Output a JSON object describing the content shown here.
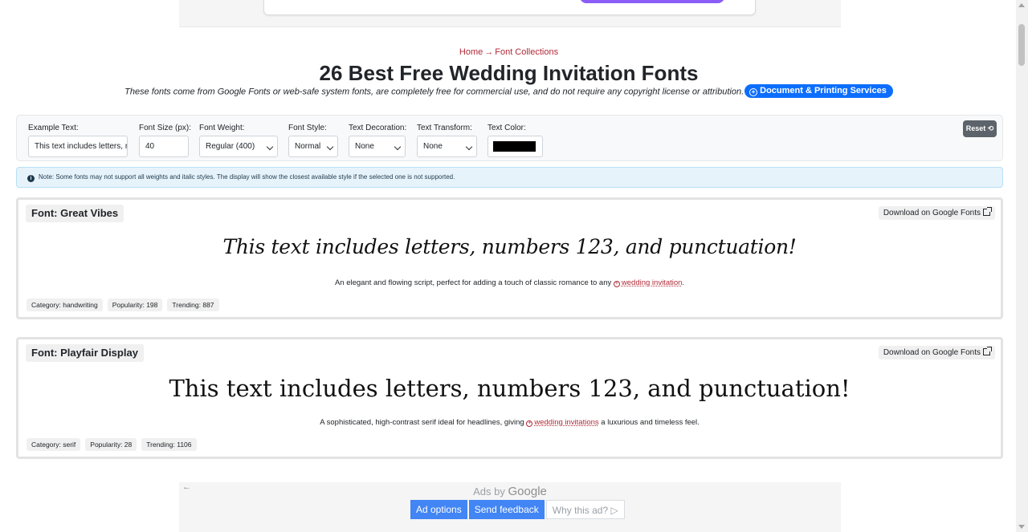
{
  "breadcrumb": {
    "home": "Home",
    "separator": "→",
    "current": "Font Collections"
  },
  "page": {
    "title": "26 Best Free Wedding Invitation Fonts",
    "subtitle": "These fonts come from Google Fonts or web-safe system fonts, are completely free for commercial use, and do not require any copyright license or attribution.",
    "doc_button": "Document & Printing Services"
  },
  "controls": {
    "example_text_label": "Example Text:",
    "example_text_value": "This text includes letters, n",
    "font_size_label": "Font Size (px):",
    "font_size_value": "40",
    "font_weight_label": "Font Weight:",
    "font_weight_value": "Regular (400)",
    "font_style_label": "Font Style:",
    "font_style_value": "Normal",
    "text_decoration_label": "Text Decoration:",
    "text_decoration_value": "None",
    "text_transform_label": "Text Transform:",
    "text_transform_value": "None",
    "text_color_label": "Text Color:",
    "text_color_value": "#000000",
    "reset_label": "Reset ⟲"
  },
  "note": "Note: Some fonts may not support all weights and italic styles. The display will show the closest available style if the selected one is not supported.",
  "fonts": [
    {
      "name": "Font: Great Vibes",
      "download": "Download on Google Fonts",
      "sample": "This text includes letters, numbers 123, and punctuation!",
      "desc_before": "An elegant and flowing script, perfect for adding a touch of classic romance to any",
      "desc_link": "wedding invitation",
      "desc_after": ".",
      "category": "Category: handwriting",
      "popularity": "Popularity: 198",
      "trending": "Trending: 887"
    },
    {
      "name": "Font: Playfair Display",
      "download": "Download on Google Fonts",
      "sample": "This text includes letters, numbers 123, and punctuation!",
      "desc_before": "A sophisticated, high-contrast serif ideal for headlines, giving",
      "desc_link": "wedding invitations",
      "desc_after": "a luxurious and timeless feel.",
      "category": "Category: serif",
      "popularity": "Popularity: 28",
      "trending": "Trending: 1106"
    }
  ],
  "ad": {
    "ads_by": "Ads by",
    "google": "Google",
    "back_arrow": "←",
    "ad_options": "Ad options",
    "send_feedback": "Send feedback",
    "why_this_ad": "Why this ad? ▷"
  }
}
